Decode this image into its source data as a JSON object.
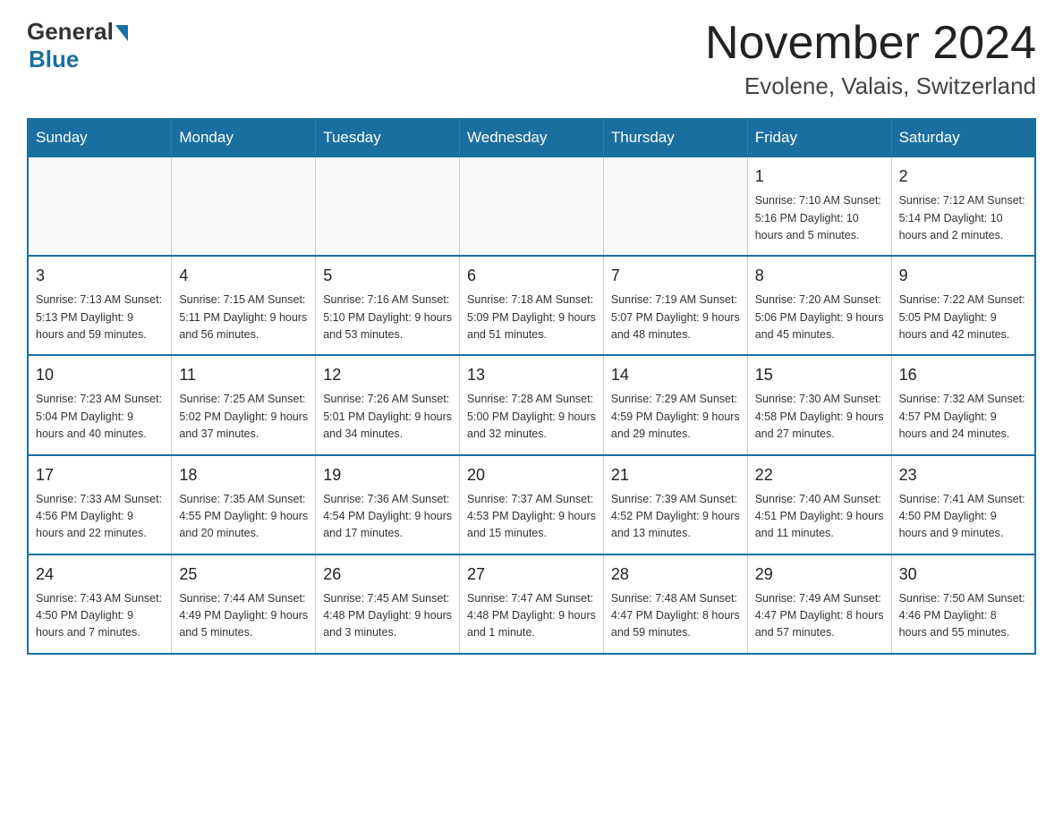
{
  "header": {
    "logo_text_general": "General",
    "logo_text_blue": "Blue",
    "title": "November 2024",
    "subtitle": "Evolene, Valais, Switzerland"
  },
  "calendar": {
    "weekdays": [
      "Sunday",
      "Monday",
      "Tuesday",
      "Wednesday",
      "Thursday",
      "Friday",
      "Saturday"
    ],
    "weeks": [
      [
        {
          "day": "",
          "info": ""
        },
        {
          "day": "",
          "info": ""
        },
        {
          "day": "",
          "info": ""
        },
        {
          "day": "",
          "info": ""
        },
        {
          "day": "",
          "info": ""
        },
        {
          "day": "1",
          "info": "Sunrise: 7:10 AM\nSunset: 5:16 PM\nDaylight: 10 hours and 5 minutes."
        },
        {
          "day": "2",
          "info": "Sunrise: 7:12 AM\nSunset: 5:14 PM\nDaylight: 10 hours and 2 minutes."
        }
      ],
      [
        {
          "day": "3",
          "info": "Sunrise: 7:13 AM\nSunset: 5:13 PM\nDaylight: 9 hours and 59 minutes."
        },
        {
          "day": "4",
          "info": "Sunrise: 7:15 AM\nSunset: 5:11 PM\nDaylight: 9 hours and 56 minutes."
        },
        {
          "day": "5",
          "info": "Sunrise: 7:16 AM\nSunset: 5:10 PM\nDaylight: 9 hours and 53 minutes."
        },
        {
          "day": "6",
          "info": "Sunrise: 7:18 AM\nSunset: 5:09 PM\nDaylight: 9 hours and 51 minutes."
        },
        {
          "day": "7",
          "info": "Sunrise: 7:19 AM\nSunset: 5:07 PM\nDaylight: 9 hours and 48 minutes."
        },
        {
          "day": "8",
          "info": "Sunrise: 7:20 AM\nSunset: 5:06 PM\nDaylight: 9 hours and 45 minutes."
        },
        {
          "day": "9",
          "info": "Sunrise: 7:22 AM\nSunset: 5:05 PM\nDaylight: 9 hours and 42 minutes."
        }
      ],
      [
        {
          "day": "10",
          "info": "Sunrise: 7:23 AM\nSunset: 5:04 PM\nDaylight: 9 hours and 40 minutes."
        },
        {
          "day": "11",
          "info": "Sunrise: 7:25 AM\nSunset: 5:02 PM\nDaylight: 9 hours and 37 minutes."
        },
        {
          "day": "12",
          "info": "Sunrise: 7:26 AM\nSunset: 5:01 PM\nDaylight: 9 hours and 34 minutes."
        },
        {
          "day": "13",
          "info": "Sunrise: 7:28 AM\nSunset: 5:00 PM\nDaylight: 9 hours and 32 minutes."
        },
        {
          "day": "14",
          "info": "Sunrise: 7:29 AM\nSunset: 4:59 PM\nDaylight: 9 hours and 29 minutes."
        },
        {
          "day": "15",
          "info": "Sunrise: 7:30 AM\nSunset: 4:58 PM\nDaylight: 9 hours and 27 minutes."
        },
        {
          "day": "16",
          "info": "Sunrise: 7:32 AM\nSunset: 4:57 PM\nDaylight: 9 hours and 24 minutes."
        }
      ],
      [
        {
          "day": "17",
          "info": "Sunrise: 7:33 AM\nSunset: 4:56 PM\nDaylight: 9 hours and 22 minutes."
        },
        {
          "day": "18",
          "info": "Sunrise: 7:35 AM\nSunset: 4:55 PM\nDaylight: 9 hours and 20 minutes."
        },
        {
          "day": "19",
          "info": "Sunrise: 7:36 AM\nSunset: 4:54 PM\nDaylight: 9 hours and 17 minutes."
        },
        {
          "day": "20",
          "info": "Sunrise: 7:37 AM\nSunset: 4:53 PM\nDaylight: 9 hours and 15 minutes."
        },
        {
          "day": "21",
          "info": "Sunrise: 7:39 AM\nSunset: 4:52 PM\nDaylight: 9 hours and 13 minutes."
        },
        {
          "day": "22",
          "info": "Sunrise: 7:40 AM\nSunset: 4:51 PM\nDaylight: 9 hours and 11 minutes."
        },
        {
          "day": "23",
          "info": "Sunrise: 7:41 AM\nSunset: 4:50 PM\nDaylight: 9 hours and 9 minutes."
        }
      ],
      [
        {
          "day": "24",
          "info": "Sunrise: 7:43 AM\nSunset: 4:50 PM\nDaylight: 9 hours and 7 minutes."
        },
        {
          "day": "25",
          "info": "Sunrise: 7:44 AM\nSunset: 4:49 PM\nDaylight: 9 hours and 5 minutes."
        },
        {
          "day": "26",
          "info": "Sunrise: 7:45 AM\nSunset: 4:48 PM\nDaylight: 9 hours and 3 minutes."
        },
        {
          "day": "27",
          "info": "Sunrise: 7:47 AM\nSunset: 4:48 PM\nDaylight: 9 hours and 1 minute."
        },
        {
          "day": "28",
          "info": "Sunrise: 7:48 AM\nSunset: 4:47 PM\nDaylight: 8 hours and 59 minutes."
        },
        {
          "day": "29",
          "info": "Sunrise: 7:49 AM\nSunset: 4:47 PM\nDaylight: 8 hours and 57 minutes."
        },
        {
          "day": "30",
          "info": "Sunrise: 7:50 AM\nSunset: 4:46 PM\nDaylight: 8 hours and 55 minutes."
        }
      ]
    ]
  }
}
